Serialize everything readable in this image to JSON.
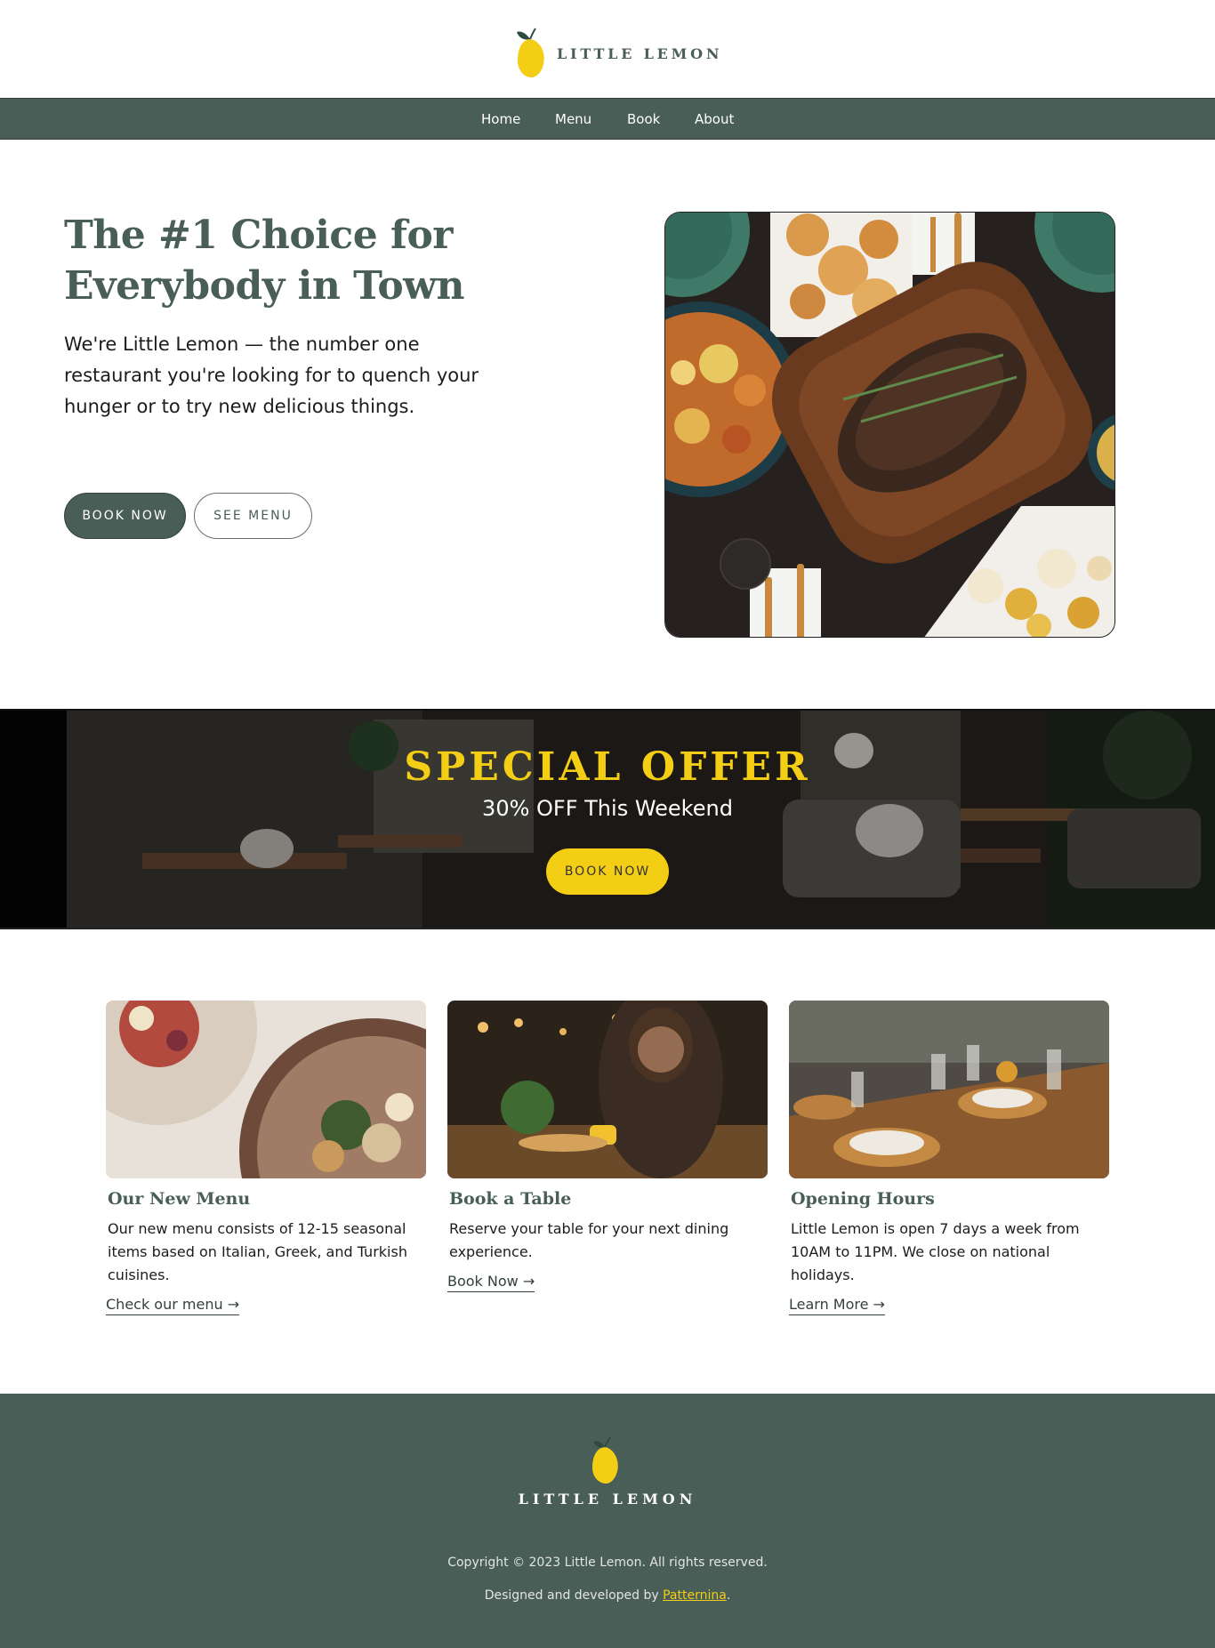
{
  "brand": {
    "name": "LITTLE LEMON",
    "accent": "#495e57",
    "highlight": "#f4ce14"
  },
  "nav": {
    "items": [
      {
        "label": "Home"
      },
      {
        "label": "Menu"
      },
      {
        "label": "Book"
      },
      {
        "label": "About"
      }
    ]
  },
  "hero": {
    "title": "The #1 Choice for Everybody in Town",
    "text": "We're Little Lemon — the number one restaurant you're looking for to quench your hunger or to try new delicious things.",
    "primary_button": "BOOK NOW",
    "secondary_button": "SEE MENU"
  },
  "offer": {
    "title": "SPECIAL OFFER",
    "subtitle": "30% OFF This Weekend",
    "button": "BOOK NOW"
  },
  "cards": [
    {
      "title": "Our New Menu",
      "text": "Our new menu consists of 12-15 seasonal items based on Italian, Greek, and Turkish cuisines.",
      "link": "Check our menu →"
    },
    {
      "title": "Book a Table",
      "text": "Reserve your table for your next dining experience.",
      "link": "Book Now →"
    },
    {
      "title": "Opening Hours",
      "text": "Little Lemon is open 7 days a week from 10AM to 11PM. We close on national holidays.",
      "link": "Learn More →"
    }
  ],
  "footer": {
    "name": "LITTLE LEMON",
    "copyright": "Copyright © 2023 Little Lemon. All rights reserved.",
    "credit_prefix": "Designed and developed by ",
    "credit_link": "Patternina",
    "credit_suffix": "."
  }
}
